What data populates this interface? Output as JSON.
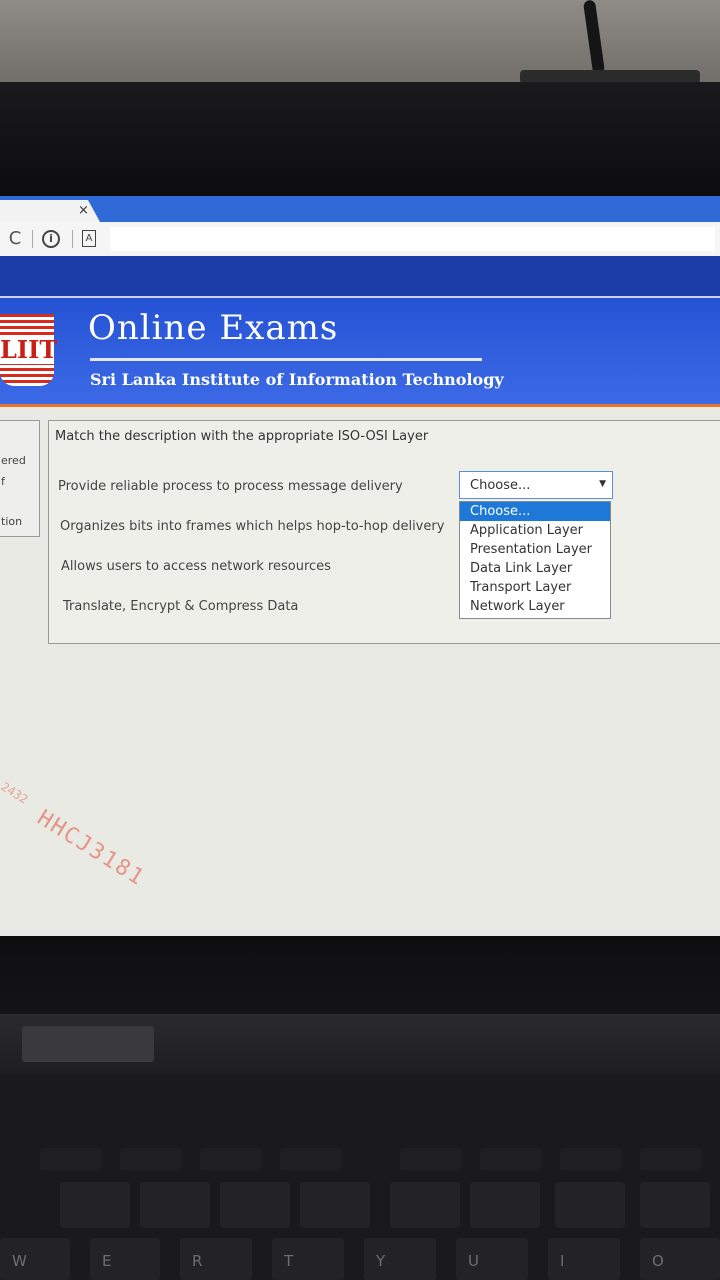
{
  "browser": {
    "tab_close": "×",
    "reload_icon": "C",
    "info_icon": "i",
    "reader_icon": "A"
  },
  "header": {
    "logo_text": "LIIT",
    "title": "Online Exams",
    "subtitle": "Sri Lanka Institute of Information Technology"
  },
  "left_panel": {
    "lines": [
      "ered",
      "f",
      "tion"
    ]
  },
  "question": {
    "title": "Match the description with the appropriate ISO-OSI Layer",
    "rows": [
      "Provide reliable process to process message delivery",
      "Organizes bits into frames which helps hop-to-hop delivery",
      "Allows users to access network resources",
      "Translate, Encrypt & Compress Data"
    ],
    "select_value": "Choose...",
    "select_arrow": "▼",
    "options": [
      "Choose...",
      "Application Layer",
      "Presentation Layer",
      "Data Link Layer",
      "Transport Layer",
      "Network Layer"
    ],
    "highlighted_option": 0
  },
  "watermark": {
    "main": "HHCJ3181",
    "small": "2432"
  },
  "keyboard": {
    "row_labels": [
      "W",
      "E",
      "R",
      "T",
      "Y",
      "U",
      "I",
      "O"
    ]
  }
}
